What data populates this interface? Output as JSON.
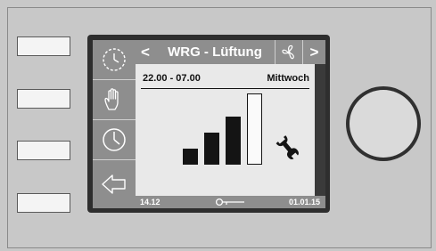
{
  "header": {
    "back_label": "<",
    "title": "WRG - Lüftung",
    "fan_icon": "fan-icon",
    "forward_label": ">"
  },
  "sidebar": {
    "items": [
      {
        "icon": "clock-dashed-icon"
      },
      {
        "icon": "hand-icon"
      },
      {
        "icon": "clock-icon"
      },
      {
        "icon": "back-arrow-icon"
      }
    ]
  },
  "schedule": {
    "time_range": "22.00 - 07.00",
    "weekday": "Mittwoch"
  },
  "level": {
    "current": 3,
    "max": 4,
    "icon": "wrench-icon"
  },
  "footer": {
    "date_left": "14.12",
    "key_icon": "key-icon",
    "date_right": "01.01.15"
  },
  "colors": {
    "panel": "#c8c8c8",
    "frame": "#2e2e2e",
    "bar_background": "#8e8e8e",
    "content_background": "#e9e9e9",
    "level_active": "#141414"
  }
}
